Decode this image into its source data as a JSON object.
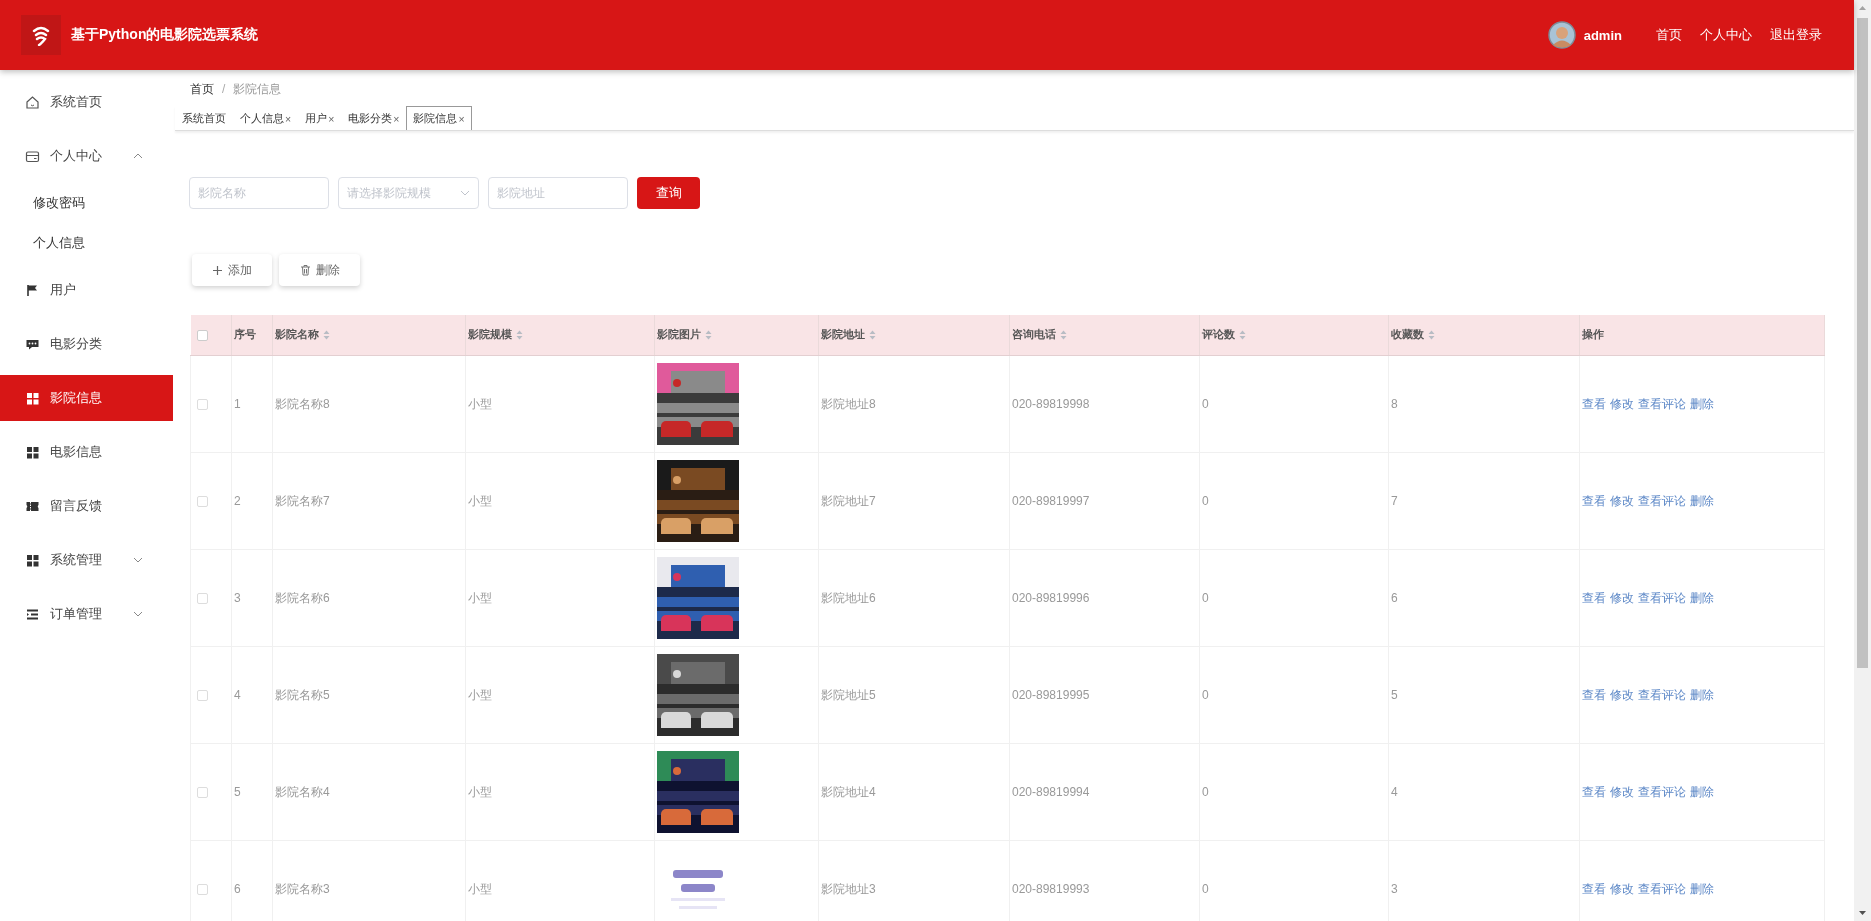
{
  "header": {
    "title": "基于Python的电影院选票系统",
    "user": "admin",
    "links": [
      "首页",
      "个人中心",
      "退出登录"
    ]
  },
  "sidebar": {
    "items": [
      {
        "label": "系统首页",
        "selected": false
      },
      {
        "label": "个人中心",
        "selected": false,
        "expanded": true,
        "children": [
          {
            "label": "修改密码",
            "selected": false
          },
          {
            "label": "个人信息",
            "selected": false
          }
        ]
      },
      {
        "label": "用户",
        "selected": false
      },
      {
        "label": "电影分类",
        "selected": false
      },
      {
        "label": "影院信息",
        "selected": true
      },
      {
        "label": "电影信息",
        "selected": false
      },
      {
        "label": "留言反馈",
        "selected": false
      },
      {
        "label": "系统管理",
        "selected": false,
        "expanded": false
      },
      {
        "label": "订单管理",
        "selected": false,
        "expanded": false
      }
    ]
  },
  "breadcrumb": [
    "首页",
    "影院信息"
  ],
  "breadcrumb_separator": "/",
  "tabs": [
    {
      "label": "系统首页",
      "selected": false
    },
    {
      "label": "个人信息",
      "close": "×",
      "selected": false
    },
    {
      "label": "用户",
      "close": "×",
      "selected": false
    },
    {
      "label": "电影分类",
      "close": "×",
      "selected": false
    },
    {
      "label": "影院信息",
      "close": "×",
      "selected": true
    }
  ],
  "filters": [
    {
      "kind": "input",
      "placeholder": "影院名称"
    },
    {
      "kind": "select",
      "placeholder": "请选择影院规模"
    },
    {
      "kind": "input",
      "placeholder": "影院地址"
    }
  ],
  "search_button": "查询",
  "toolbar": [
    {
      "kind": "add",
      "label": "添加"
    },
    {
      "kind": "delete",
      "label": "删除"
    }
  ],
  "table": {
    "all_checked": false,
    "columns": [
      {
        "kind": "text",
        "label": "序号",
        "sortable": false
      },
      {
        "kind": "text",
        "label": "影院名称",
        "sortable": true
      },
      {
        "kind": "text",
        "label": "影院规模",
        "sortable": true
      },
      {
        "label": "影院图片",
        "sortable": true
      },
      {
        "kind": "text",
        "label": "影院地址",
        "sortable": true
      },
      {
        "kind": "text",
        "label": "咨询电话",
        "sortable": true
      },
      {
        "kind": "text",
        "label": "评论数",
        "sortable": true
      },
      {
        "kind": "text",
        "label": "收藏数",
        "sortable": true
      },
      {
        "kind": "actions",
        "label": "操作",
        "sortable": false
      }
    ],
    "rows": [
      {
        "checked": false,
        "cells": [
          "1",
          "影院名称8",
          "小型",
          {
            "kind": "picture"
          },
          "影院地址8",
          "020-89819998",
          "0",
          "8",
          [
            "查看",
            "修改",
            "查看评论",
            "删除"
          ]
        ]
      },
      {
        "checked": false,
        "cells": [
          "2",
          "影院名称7",
          "小型",
          {
            "kind": "picture"
          },
          "影院地址7",
          "020-89819997",
          "0",
          "7",
          [
            "查看",
            "修改",
            "查看评论",
            "删除"
          ]
        ]
      },
      {
        "checked": false,
        "cells": [
          "3",
          "影院名称6",
          "小型",
          {
            "kind": "picture"
          },
          "影院地址6",
          "020-89819996",
          "0",
          "6",
          [
            "查看",
            "修改",
            "查看评论",
            "删除"
          ]
        ]
      },
      {
        "checked": false,
        "cells": [
          "4",
          "影院名称5",
          "小型",
          {
            "kind": "picture"
          },
          "影院地址5",
          "020-89819995",
          "0",
          "5",
          [
            "查看",
            "修改",
            "查看评论",
            "删除"
          ]
        ]
      },
      {
        "checked": false,
        "cells": [
          "5",
          "影院名称4",
          "小型",
          {
            "kind": "picture"
          },
          "影院地址4",
          "020-89819994",
          "0",
          "4",
          [
            "查看",
            "修改",
            "查看评论",
            "删除"
          ]
        ]
      },
      {
        "checked": false,
        "cells": [
          "6",
          "影院名称3",
          "小型",
          {
            "kind": "picture"
          },
          "影院地址3",
          "020-89819993",
          "0",
          "3",
          [
            "查看",
            "修改",
            "查看评论",
            "删除"
          ]
        ]
      }
    ]
  }
}
